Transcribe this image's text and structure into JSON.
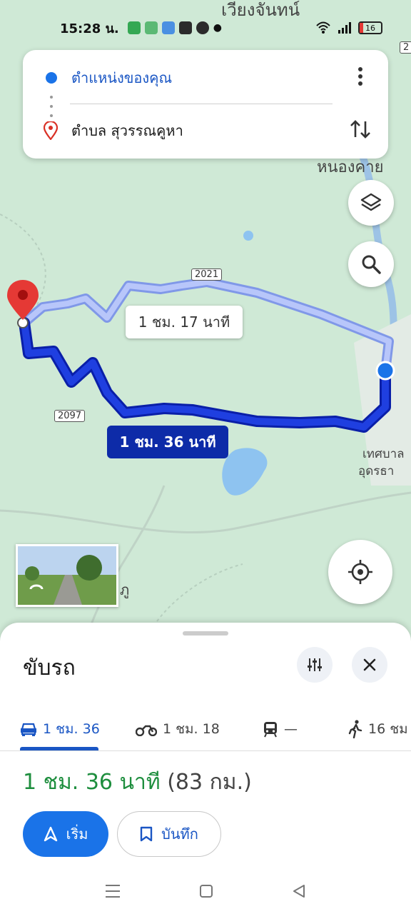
{
  "status_bar": {
    "time": "15:28 น.",
    "battery": "16"
  },
  "route_card": {
    "origin": "ตำแหน่งของคุณ",
    "destination": "ตำบล สุวรรณคูหา"
  },
  "map": {
    "labels": {
      "top_city": "เวียงจันทน์",
      "nong_khai": "หนองคาย",
      "municipality_1": "เทศบาล",
      "municipality_2": "อุดรธา",
      "road_2021": "2021",
      "road_2097": "2097",
      "road_2_small": "2",
      "streetview_letter": "ภู"
    },
    "alt_route_label": "1 ชม. 17 นาที",
    "main_route_label": "1 ชม. 36 นาที"
  },
  "sheet": {
    "title": "ขับรถ",
    "modes": [
      {
        "icon": "car-icon",
        "label": "1 ชม. 36"
      },
      {
        "icon": "motorcycle-icon",
        "label": "1 ชม. 18"
      },
      {
        "icon": "train-icon",
        "label": "—"
      },
      {
        "icon": "walking-icon",
        "label": "16 ชม"
      }
    ],
    "summary_duration": "1 ชม. 36 นาที",
    "summary_distance": "(83 กม.)",
    "start_label": "เริ่ม",
    "save_label": "บันทึก"
  },
  "colors": {
    "accent": "#1a73e8",
    "route_main": "#1f3fe0",
    "route_alt": "#a8b8f5",
    "duration_green": "#1e8e3e"
  }
}
